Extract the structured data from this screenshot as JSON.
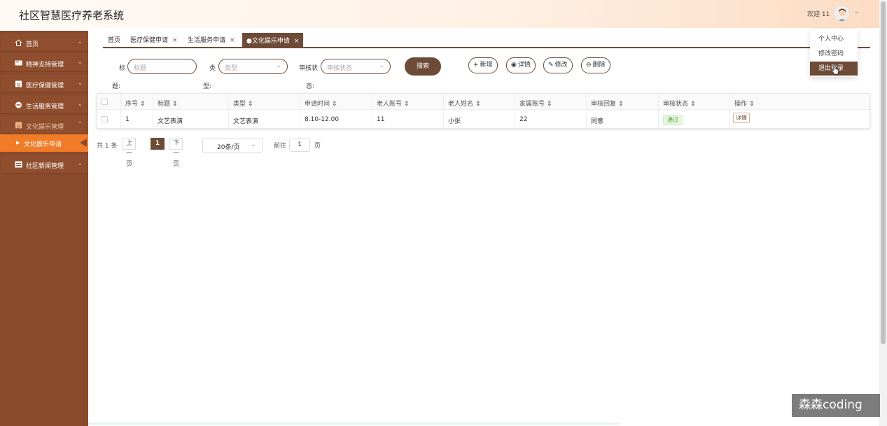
{
  "header": {
    "app_title": "社区智慧医疗养老系统",
    "welcome": "欢迎 11"
  },
  "sidebar": {
    "items": [
      {
        "label": "首页",
        "icon": "home-icon"
      },
      {
        "label": "精神支持管理",
        "icon": "card-icon"
      },
      {
        "label": "医疗保健管理",
        "icon": "medical-icon"
      },
      {
        "label": "生活服务管理",
        "icon": "service-icon"
      },
      {
        "label": "文化娱乐管理",
        "icon": "culture-icon"
      },
      {
        "label": "社区新闻管理",
        "icon": "news-icon"
      }
    ],
    "active_sub": "文化娱乐申请"
  },
  "tabs": [
    {
      "label": "首页",
      "closable": false
    },
    {
      "label": "医疗保健申请",
      "closable": true
    },
    {
      "label": "生活服务申请",
      "closable": true
    },
    {
      "label": "●文化娱乐申请",
      "closable": true,
      "active": true
    }
  ],
  "search": {
    "title_label_1": "标",
    "title_label_2": "题:",
    "title_placeholder": "标题",
    "type_label_1": "类",
    "type_label_2": "型:",
    "type_placeholder": "类型",
    "status_label_1": "审核状",
    "status_label_2": "态:",
    "status_placeholder": "审核状态",
    "search_button": "搜索"
  },
  "toolbar": {
    "add": "新增",
    "detail": "详情",
    "edit": "修改",
    "delete": "删除"
  },
  "table": {
    "columns": [
      "序号",
      "标题",
      "类型",
      "申请时间",
      "老人账号",
      "老人姓名",
      "家属账号",
      "审核回复",
      "审核状态",
      "操作"
    ],
    "rows": [
      {
        "index": "1",
        "title": "文艺表演",
        "type": "文艺表演",
        "time": "8.10-12.00",
        "elder_account": "11",
        "elder_name": "小张",
        "family_account": "22",
        "reply": "同意",
        "status": "通过",
        "action": "详情"
      }
    ]
  },
  "pager": {
    "total": "共 1 条",
    "prev": "上一页",
    "current": "1",
    "next": "下一页",
    "page_size": "20条/页",
    "goto": "前往",
    "goto_value": "1",
    "page_unit": "页"
  },
  "user_menu": {
    "items": [
      "个人中心",
      "修改密码",
      "退出登录"
    ]
  },
  "watermark": "森森coding",
  "colors": {
    "sidebar": "#8a4a2c",
    "accent": "#6d4b36",
    "active_sub": "#f07c28",
    "status_ok": "#5a9e3a"
  }
}
